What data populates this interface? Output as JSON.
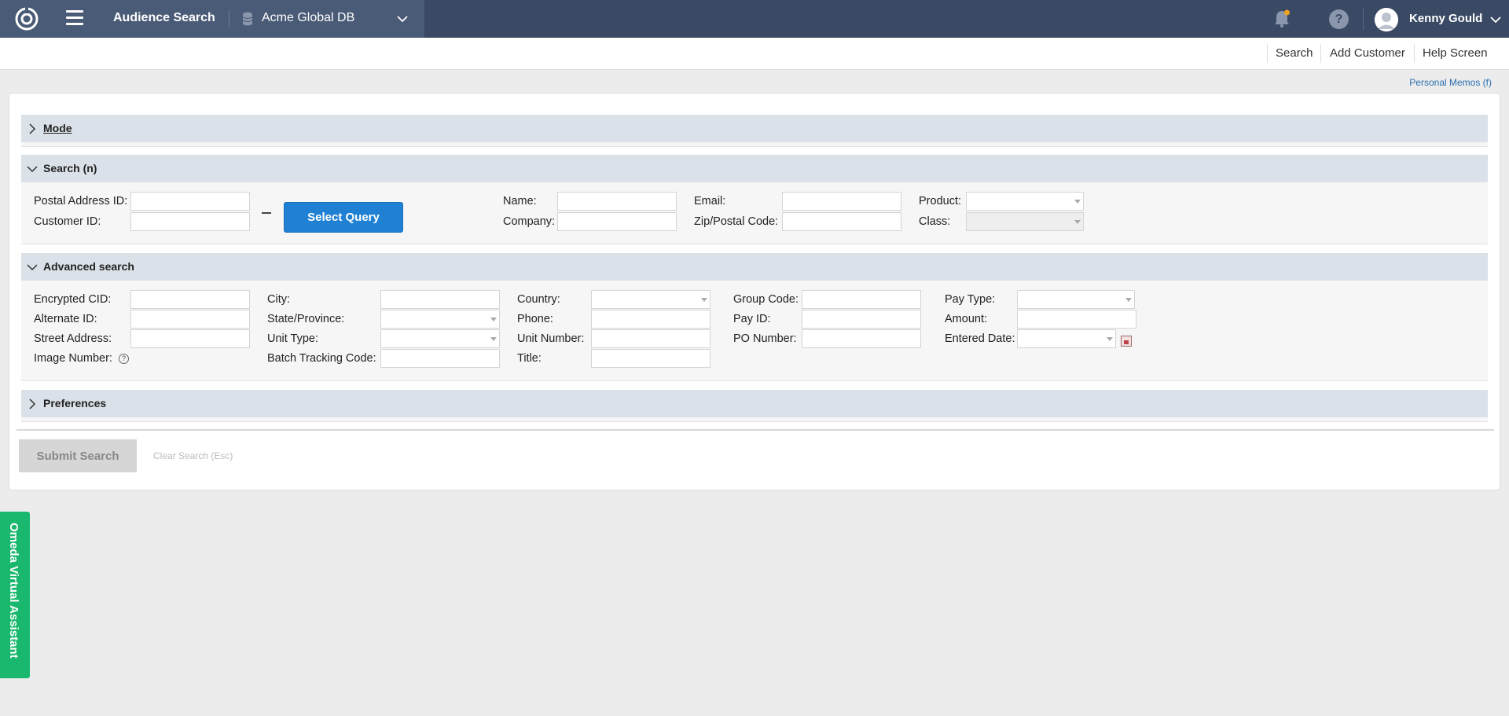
{
  "topbar": {
    "app_title": "Audience Search",
    "db_name": "Acme Global DB",
    "user_name": "Kenny Gould",
    "help_glyph": "?"
  },
  "subnav": {
    "search": "Search",
    "add_customer": "Add Customer",
    "help_screen": "Help Screen"
  },
  "memos": "Personal Memos (f)",
  "sections": {
    "mode": "Mode",
    "search": "Search (n)",
    "advanced": "Advanced search",
    "preferences": "Preferences"
  },
  "search": {
    "postal_address_id": "Postal Address ID:",
    "customer_id": "Customer ID:",
    "select_query": "Select Query",
    "name": "Name:",
    "company": "Company:",
    "email": "Email:",
    "zip": "Zip/Postal Code:",
    "product": "Product:",
    "class": "Class:"
  },
  "advanced": {
    "encrypted_cid": "Encrypted CID:",
    "alternate_id": "Alternate ID:",
    "street_address": "Street Address:",
    "image_number": "Image Number:",
    "city": "City:",
    "state_province": "State/Province:",
    "unit_type": "Unit Type:",
    "batch_tracking_code": "Batch Tracking Code:",
    "country": "Country:",
    "phone": "Phone:",
    "unit_number": "Unit Number:",
    "title": "Title:",
    "group_code": "Group Code:",
    "pay_id": "Pay ID:",
    "po_number": "PO Number:",
    "pay_type": "Pay Type:",
    "amount": "Amount:",
    "entered_date": "Entered Date:"
  },
  "actions": {
    "submit": "Submit Search",
    "clear": "Clear Search (Esc)"
  },
  "assistant": "Omeda Virtual Assistant",
  "colors": {
    "topbar": "#3a4a64",
    "accent_button": "#1f80d4",
    "assistant": "#19b86e",
    "section_header": "#dbe1e8"
  }
}
